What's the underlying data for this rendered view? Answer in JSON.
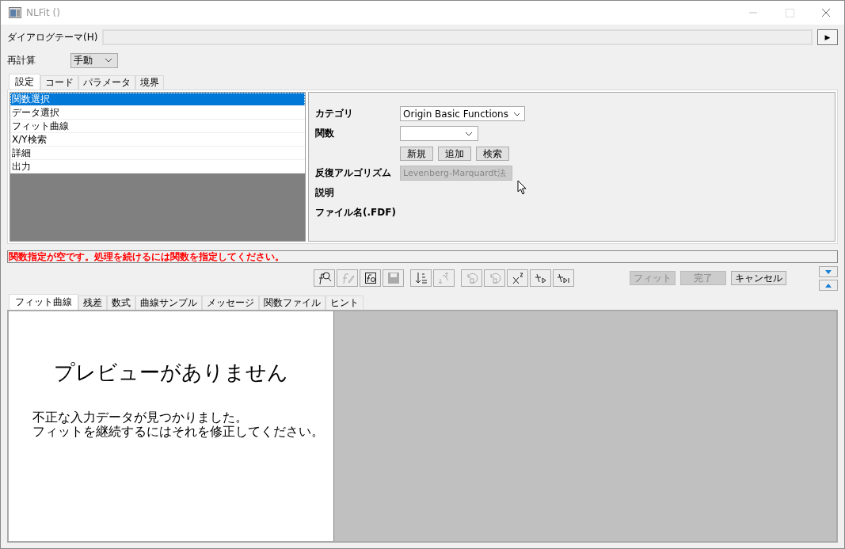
{
  "window": {
    "title": "NLFit ()",
    "active": false
  },
  "dialog_theme": {
    "label": "ダイアログテーマ(H)",
    "button": "▶"
  },
  "recalculate": {
    "label": "再計算",
    "value": "手動"
  },
  "tabs": [
    {
      "label": "設定",
      "selected": true
    },
    {
      "label": "コード",
      "selected": false
    },
    {
      "label": "パラメータ",
      "selected": false
    },
    {
      "label": "境界",
      "selected": false
    }
  ],
  "steps": [
    {
      "label": "関数選択",
      "selected": true
    },
    {
      "label": "データ選択",
      "selected": false
    },
    {
      "label": "フィット曲線",
      "selected": false
    },
    {
      "label": "X/Y検索",
      "selected": false
    },
    {
      "label": "詳細",
      "selected": false
    },
    {
      "label": "出力",
      "selected": false
    }
  ],
  "settings": {
    "category": {
      "label": "カテゴリ",
      "value": "Origin Basic Functions"
    },
    "function": {
      "label": "関数"
    },
    "buttons": [
      "新規",
      "追加",
      "検索"
    ],
    "algorithm": {
      "label": "反復アルゴリズム",
      "value": "Levenberg-Marquardt法",
      "disabled": true
    },
    "description": {
      "label": "説明"
    },
    "file_name": {
      "label": "ファイル名(.FDF)"
    }
  },
  "status_message": "関数指定が空です。処理を続けるには関数を指定してください。",
  "toolbar_groups": [
    [
      {
        "kind": "search",
        "disabled": false
      },
      {
        "kind": "edit",
        "disabled": true
      },
      {
        "kind": "file",
        "disabled": false
      },
      {
        "kind": "save",
        "disabled": true
      }
    ],
    [
      {
        "kind": "sort",
        "disabled": false
      },
      {
        "kind": "swap",
        "disabled": true
      }
    ],
    [
      {
        "kind": "undo",
        "disabled": true
      },
      {
        "kind": "undo",
        "disabled": true
      },
      {
        "kind": "chi",
        "disabled": false
      },
      {
        "kind": "step",
        "disabled": false
      },
      {
        "kind": "step-end",
        "disabled": false
      }
    ]
  ],
  "action_buttons": [
    {
      "label": "フィット",
      "disabled": true
    },
    {
      "label": "完了",
      "disabled": true
    },
    {
      "label": "キャンセル",
      "disabled": false
    }
  ],
  "bottom_tabs": [
    {
      "label": "フィット曲線",
      "selected": true
    },
    {
      "label": "残差",
      "selected": false
    },
    {
      "label": "数式",
      "selected": false
    },
    {
      "label": "曲線サンプル",
      "selected": false
    },
    {
      "label": "メッセージ",
      "selected": false
    },
    {
      "label": "関数ファイル",
      "selected": false
    },
    {
      "label": "ヒント",
      "selected": false
    }
  ],
  "preview": {
    "title": "プレビューがありません",
    "message_lines": [
      "不正な入力データが見つかりました。",
      "フィットを継続するにはそれを修正してください。"
    ]
  }
}
